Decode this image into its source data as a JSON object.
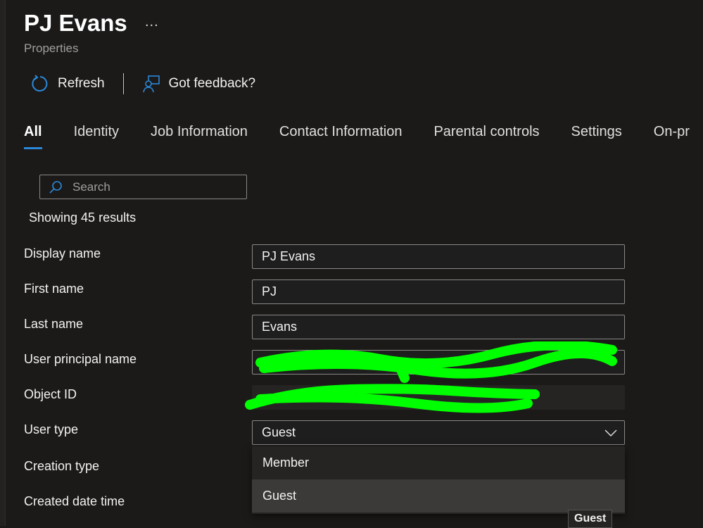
{
  "header": {
    "title": "PJ Evans",
    "more": "...",
    "subtitle": "Properties"
  },
  "toolbar": {
    "refresh": "Refresh",
    "feedback": "Got feedback?"
  },
  "tabs": [
    "All",
    "Identity",
    "Job Information",
    "Contact Information",
    "Parental controls",
    "Settings",
    "On-pr"
  ],
  "search": {
    "placeholder": "Search",
    "value": ""
  },
  "results": "Showing 45 results",
  "fields": [
    {
      "label": "Display name",
      "value": "PJ Evans"
    },
    {
      "label": "First name",
      "value": "PJ"
    },
    {
      "label": "Last name",
      "value": "Evans"
    },
    {
      "label": "User principal name",
      "value": ""
    },
    {
      "label": "Object ID",
      "value": ""
    },
    {
      "label": "User type",
      "value": "Guest"
    },
    {
      "label": "Creation type"
    },
    {
      "label": "Created date time"
    }
  ],
  "dropdown": {
    "options": [
      "Member",
      "Guest"
    ],
    "highlighted": "Guest"
  },
  "tooltip": "Guest",
  "colors": {
    "accent": "#2b88d8",
    "redaction": "#00ff00",
    "background": "#1b1a19"
  }
}
